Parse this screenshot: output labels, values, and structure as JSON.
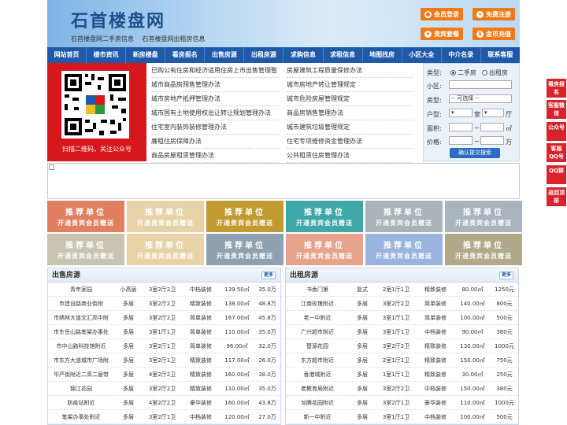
{
  "header": {
    "logo": "石首楼盘网",
    "sublinks": [
      "石首楼盘网二手房信息",
      "石首楼盘网出租房信息"
    ],
    "buttons": [
      {
        "label": "会员登录",
        "icon": "user-icon"
      },
      {
        "label": "免费注册",
        "icon": "register-icon"
      },
      {
        "label": "贵宾套餐",
        "icon": "vip-icon"
      },
      {
        "label": "金币充值",
        "icon": "coin-icon"
      }
    ]
  },
  "nav": [
    "网站首页",
    "楼市资讯",
    "新房楼盘",
    "看房报名",
    "出售房源",
    "出租房源",
    "求购信息",
    "求租信息",
    "地图找房",
    "小区大全",
    "中介名录",
    "联系客服"
  ],
  "qr": {
    "caption": "扫描二维码，关注公众号"
  },
  "links": {
    "left": [
      "已购公有住房和经济适用住房上市出售管理暂",
      "城市商品房预售管理办法",
      "城市房地产抵押管理办法",
      "城市国有土地使用权出让转让规划管理办法",
      "住宅室内装饰装修管理办法",
      "廉租住房保障办法",
      "商品房屋租赁管理办法"
    ],
    "right": [
      "房屋建筑工程质量保修办法",
      "城市房地产转让管理规定",
      "城市危险房屋管理规定",
      "商品房销售管理办法",
      "城市建筑垃圾管理规定",
      "住宅专项维修资金管理办法",
      "公共租赁住房管理办法"
    ]
  },
  "search": {
    "type_label": "类型:",
    "type_options": [
      "二手房",
      "出租房"
    ],
    "xiaoqu_label": "小区:",
    "fangxing_label": "房型:",
    "fangxing_value": "-- 可选择 --",
    "huxing_label": "户型:",
    "shi": "室",
    "ting": "厅",
    "mianji_label": "面积:",
    "mianji_unit": "㎡",
    "jiage_label": "价格:",
    "jiage_unit": "万",
    "tilde": "~",
    "submit": "确认提交搜索"
  },
  "ads": {
    "line1": "推荐单位",
    "line2": "开通贵宾会员赠送",
    "colors": [
      "#e08060",
      "#e8d3a8",
      "#c19a30",
      "#3fa7a8",
      "#a9b3b8",
      "#a9b4be",
      "#c9c3b2",
      "#e8d3a8",
      "#8fa0ae",
      "#e7a28c",
      "#9ab4de",
      "#b0aa8a"
    ]
  },
  "sale": {
    "title": "出售房源",
    "more": "更多",
    "rows": [
      [
        "青年家园",
        "小高层",
        "3室2厅2卫",
        "中档装修",
        "139.50㎡",
        "35.0万"
      ],
      [
        "市建设路商业街附",
        "多层",
        "3室2厅2卫",
        "精致装修",
        "138.00㎡",
        "48.8万"
      ],
      [
        "市绣林大道文汇高中附",
        "多层",
        "3室2厅2卫",
        "简单装修",
        "167.00㎡",
        "45.8万"
      ],
      [
        "市东岳山路笔架办事处",
        "多层",
        "3室1厅1卫",
        "简单装修",
        "110.00㎡",
        "35.0万"
      ],
      [
        "市中山路科技馆附近",
        "多层",
        "3室2厅1卫",
        "简单装修",
        "96.00㎡",
        "32.0万"
      ],
      [
        "市东方大道城市广场附",
        "多层",
        "3室2厅1卫",
        "精致装修",
        "117.00㎡",
        "26.0万"
      ],
      [
        "华严街附近二高二层带",
        "多层",
        "4室2厅2卫",
        "精致装修",
        "160.00㎡",
        "38.0万"
      ],
      [
        "锦江花园",
        "多层",
        "3室2厅2卫",
        "精致装修",
        "110.00㎡",
        "35.0万"
      ],
      [
        "防疫站附近",
        "多层",
        "4室2厅2卫",
        "豪华装修",
        "160.00㎡",
        "43.8万"
      ],
      [
        "笔架办事处附近",
        "多层",
        "3室2厅1卫",
        "中档装修",
        "120.00㎡",
        "27.0万"
      ]
    ]
  },
  "rent": {
    "title": "出租房源",
    "more": "更多",
    "rows": [
      [
        "书香门第",
        "复式",
        "2室1厅1卫",
        "精致装修",
        "80.00㎡",
        "1250元"
      ],
      [
        "江南玫瑰附近",
        "多层",
        "3室2厅2卫",
        "简单装修",
        "140.00㎡",
        "800元"
      ],
      [
        "老一中附近",
        "多层",
        "3室1厅1卫",
        "简单装修",
        "100.00㎡",
        "500元"
      ],
      [
        "广兴超市附近",
        "多层",
        "3室1厅1卫",
        "中档装修",
        "90.00㎡",
        "380元"
      ],
      [
        "楚源花园",
        "多层",
        "3室2厅2卫",
        "精致装修",
        "130.00㎡",
        "1000元"
      ],
      [
        "东方超市附近",
        "多层",
        "2室1厅1卫",
        "精致装修",
        "150.00㎡",
        "750元"
      ],
      [
        "香港城附近",
        "多层",
        "1室1厅1卫",
        "精致装修",
        "30.00㎡",
        "250元"
      ],
      [
        "老教育局附近",
        "多层",
        "3室2厅2卫",
        "中档装修",
        "150.00㎡",
        "380元"
      ],
      [
        "龙腾花园附近",
        "多层",
        "3室2厅1卫",
        "豪华装修",
        "110.00㎡",
        "1000元"
      ],
      [
        "新一中附近",
        "多层",
        "3室1厅1卫",
        "中档装修",
        "100.00㎡",
        "500元"
      ]
    ]
  },
  "sidebar": [
    "看房报名",
    "客服微信",
    "公众号",
    "客服QQ号",
    "QQ群",
    "返回顶部"
  ]
}
